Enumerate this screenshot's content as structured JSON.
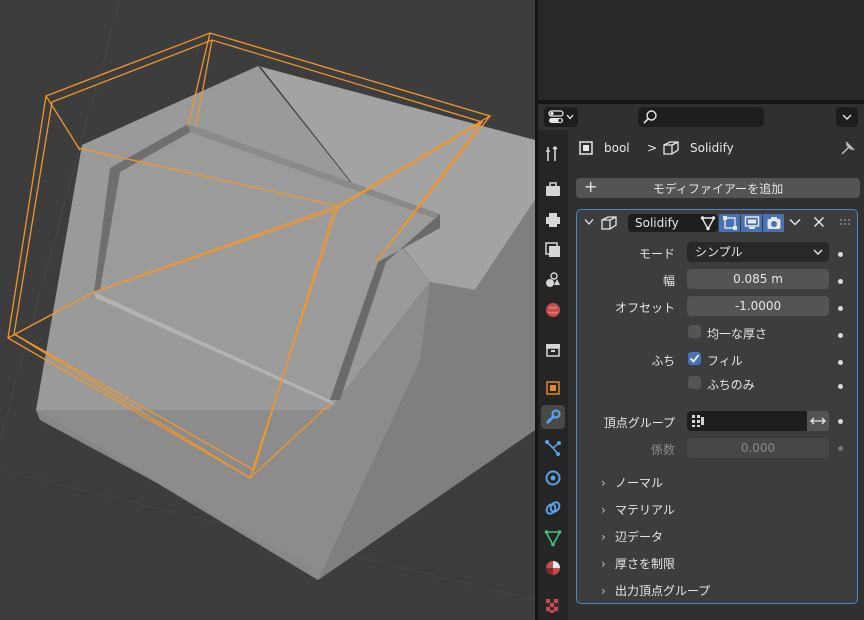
{
  "breadcrumb": {
    "object": "bool",
    "separator": ">",
    "modifier": "Solidify"
  },
  "add_modifier_label": "モディファイアーを追加",
  "modifier": {
    "name": "Solidify",
    "mode_label": "モード",
    "mode_value": "シンプル",
    "thickness_label": "幅",
    "thickness_value": "0.085 m",
    "offset_label": "オフセット",
    "offset_value": "-1.0000",
    "even_thickness_label": "均一な厚さ",
    "rim_label": "ふち",
    "fill_label": "フィル",
    "fill_checked": true,
    "rim_only_label": "ふちのみ",
    "vertex_group_label": "頂点グループ",
    "factor_label": "係数",
    "factor_value": "0.000",
    "subpanels": [
      "ノーマル",
      "マテリアル",
      "辺データ",
      "厚さを制限",
      "出力頂点グループ"
    ]
  },
  "tabs": [
    "tool-icon",
    "render-icon",
    "output-icon",
    "view-layer-icon",
    "scene-icon",
    "world-icon",
    "collection-icon",
    "object-icon",
    "modifier-icon",
    "particles-icon",
    "physics-icon",
    "constraints-icon",
    "data-icon",
    "material-icon",
    "texture-icon"
  ],
  "colors": {
    "accent": "#4772b3",
    "selection_outline": "#f0962e",
    "panel_border": "#4a86c8"
  }
}
